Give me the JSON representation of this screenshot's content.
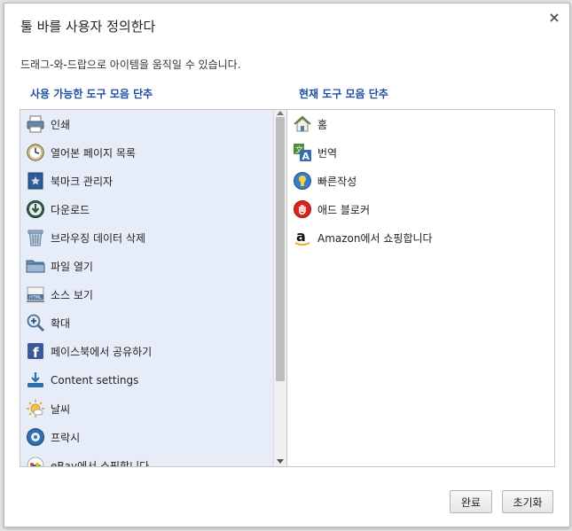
{
  "dialog": {
    "title": "툴 바를 사용자 정의한다",
    "close_label": "×",
    "instruction": "드래그-와-드랍으로 아이템을 움직일 수 있습니다."
  },
  "available": {
    "header": "사용 가능한 도구 모음 단추",
    "items": [
      {
        "label": "인쇄",
        "icon": "printer-icon"
      },
      {
        "label": "열어본 페이지 목록",
        "icon": "clock-icon"
      },
      {
        "label": "북마크 관리자",
        "icon": "bookmark-star-icon"
      },
      {
        "label": "다운로드",
        "icon": "download-icon"
      },
      {
        "label": "브라우징 데이터 삭제",
        "icon": "trash-icon"
      },
      {
        "label": "파일 열기",
        "icon": "folder-icon"
      },
      {
        "label": "소스 보기",
        "icon": "html-source-icon"
      },
      {
        "label": "확대",
        "icon": "zoom-in-icon"
      },
      {
        "label": "페이스북에서 공유하기",
        "icon": "facebook-icon"
      },
      {
        "label": "Content settings",
        "icon": "content-download-icon"
      },
      {
        "label": "날씨",
        "icon": "weather-sun-icon"
      },
      {
        "label": "프락시",
        "icon": "proxy-icon"
      },
      {
        "label": "eBay에서 쇼핑합니다",
        "icon": "ebay-icon"
      }
    ]
  },
  "current": {
    "header": "현재 도구 모음 단추",
    "items": [
      {
        "label": "홈",
        "icon": "home-icon"
      },
      {
        "label": "번역",
        "icon": "translate-icon"
      },
      {
        "label": "빠른작성",
        "icon": "quick-write-icon"
      },
      {
        "label": "애드 블로커",
        "icon": "ad-blocker-icon"
      },
      {
        "label": "Amazon에서 쇼핑합니다",
        "icon": "amazon-icon"
      }
    ]
  },
  "buttons": {
    "done": "완료",
    "reset": "초기화"
  },
  "colors": {
    "header_blue": "#1f4fa0",
    "left_panel_bg": "#e7edf8"
  }
}
